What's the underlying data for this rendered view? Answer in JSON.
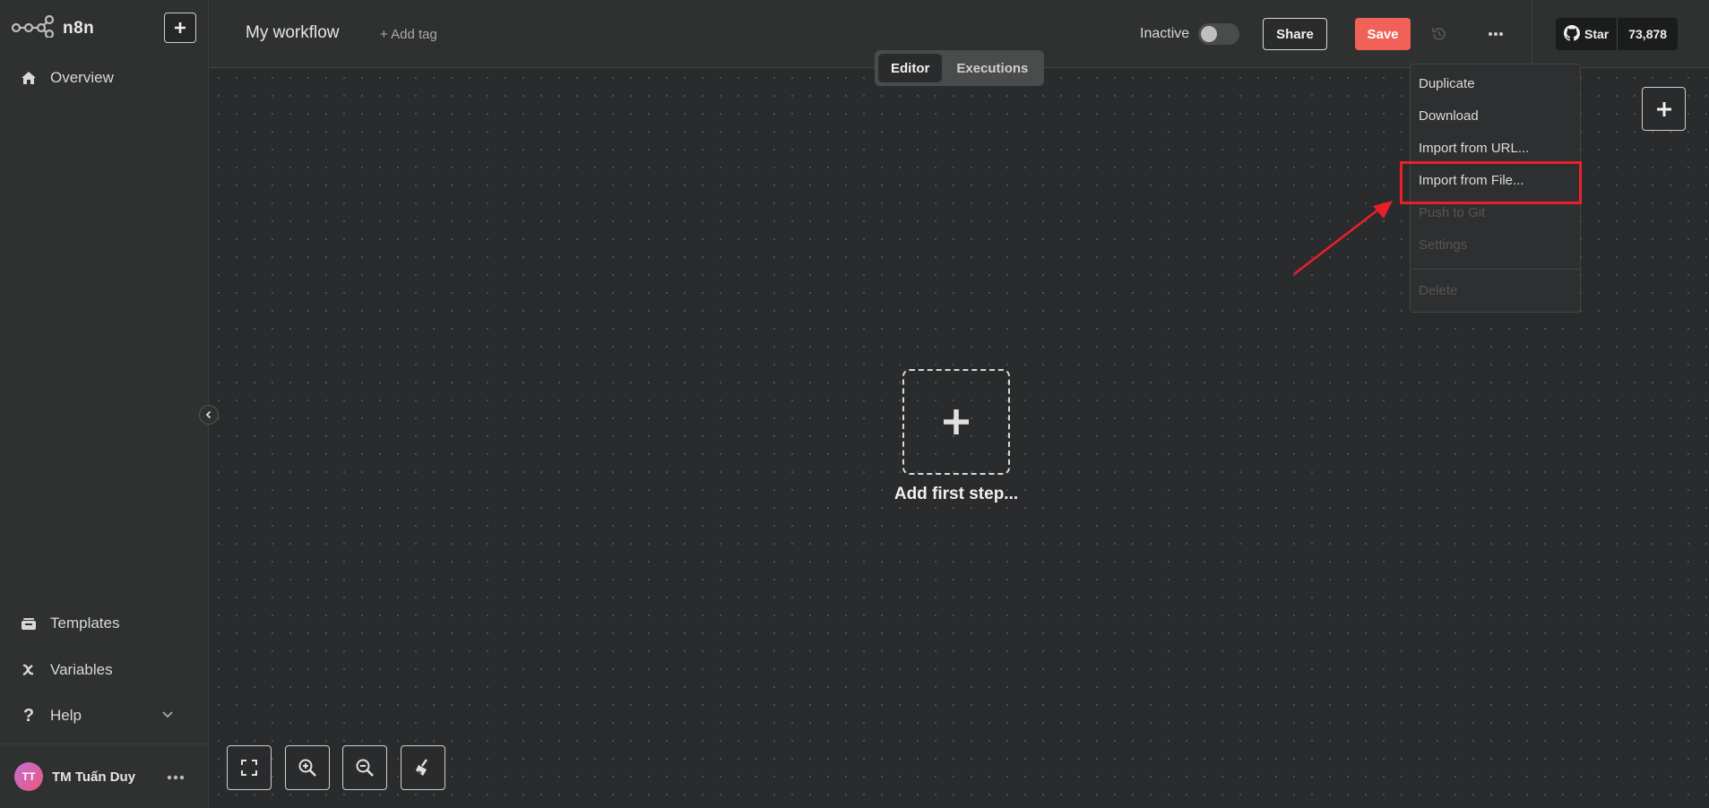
{
  "brand": {
    "name": "n8n"
  },
  "sidebar": {
    "items": [
      {
        "label": "Overview",
        "icon": "home-icon"
      },
      {
        "label": "Templates",
        "icon": "templates-icon"
      },
      {
        "label": "Variables",
        "icon": "variables-icon"
      },
      {
        "label": "Help",
        "icon": "help-icon"
      }
    ],
    "user": {
      "initials": "TT",
      "name": "TM Tuấn Duy"
    }
  },
  "header": {
    "workflow_title": "My workflow",
    "add_tag": "+ Add tag",
    "status_label": "Inactive",
    "share_label": "Share",
    "save_label": "Save",
    "github": {
      "star_label": "Star",
      "star_count": "73,878"
    }
  },
  "tabs": [
    {
      "label": "Editor",
      "active": true
    },
    {
      "label": "Executions",
      "active": false
    }
  ],
  "canvas": {
    "add_first_step": "Add first step..."
  },
  "menu": {
    "items": [
      {
        "label": "Duplicate",
        "enabled": true
      },
      {
        "label": "Download",
        "enabled": true
      },
      {
        "label": "Import from URL...",
        "enabled": true
      },
      {
        "label": "Import from File...",
        "enabled": true,
        "highlighted": true
      },
      {
        "label": "Push to Git",
        "enabled": false
      },
      {
        "label": "Settings",
        "enabled": false
      },
      {
        "label": "Delete",
        "enabled": false
      }
    ]
  },
  "colors": {
    "accent": "#f06158",
    "highlight": "#e8202a",
    "background": "#2a2b2c"
  }
}
